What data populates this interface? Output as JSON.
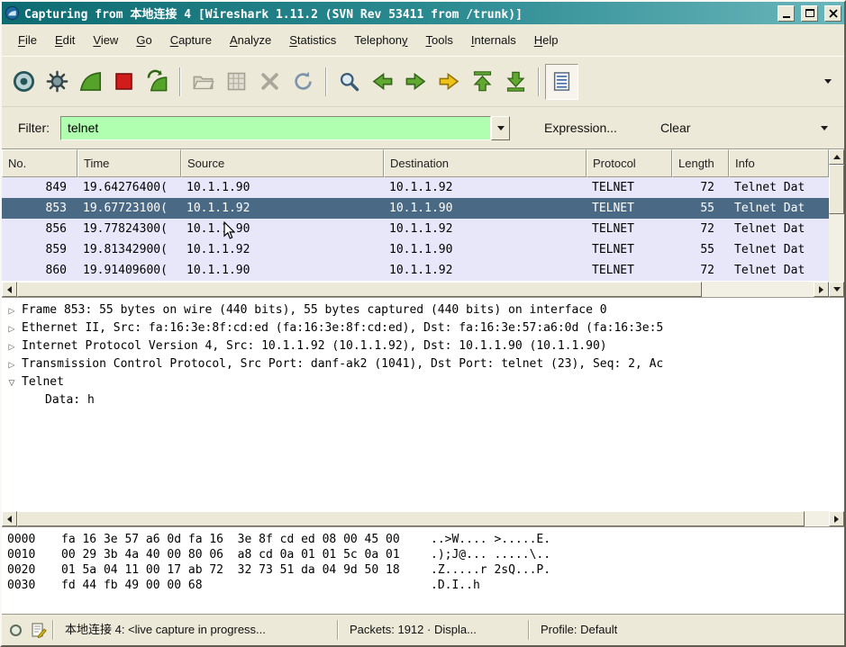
{
  "window": {
    "title": "Capturing from 本地连接 4    [Wireshark 1.11.2  (SVN Rev 53411 from /trunk)]"
  },
  "menu": {
    "items": [
      {
        "label": "File",
        "accel": 0
      },
      {
        "label": "Edit",
        "accel": 0
      },
      {
        "label": "View",
        "accel": 0
      },
      {
        "label": "Go",
        "accel": 0
      },
      {
        "label": "Capture",
        "accel": 0
      },
      {
        "label": "Analyze",
        "accel": 0
      },
      {
        "label": "Statistics",
        "accel": 0
      },
      {
        "label": "Telephony",
        "accel": 8
      },
      {
        "label": "Tools",
        "accel": 0
      },
      {
        "label": "Internals",
        "accel": 0
      },
      {
        "label": "Help",
        "accel": 0
      }
    ]
  },
  "toolbar": {
    "icons": [
      "list-interfaces",
      "capture-options",
      "start-capture",
      "stop-capture",
      "restart-capture",
      "open-file",
      "save-file",
      "close-file",
      "reload",
      "find-packet",
      "go-back",
      "go-forward",
      "go-to-packet",
      "go-to-top",
      "go-to-bottom",
      "colorize-list",
      "overflow-menu"
    ]
  },
  "filter": {
    "label": "Filter:",
    "value": "telnet",
    "expression_button": "Expression...",
    "clear_button": "Clear",
    "valid_bg": "#b0ffb0"
  },
  "packet_list": {
    "columns": [
      "No.",
      "Time",
      "Source",
      "Destination",
      "Protocol",
      "Length",
      "Info"
    ],
    "selected_color": "#4a6984",
    "row_color": "#e8e7f9",
    "rows": [
      {
        "no": "849",
        "time": "19.64276400(",
        "source": "10.1.1.90",
        "destination": "10.1.1.92",
        "protocol": "TELNET",
        "length": "72",
        "info": "Telnet Dat",
        "selected": false
      },
      {
        "no": "853",
        "time": "19.67723100(",
        "source": "10.1.1.92",
        "destination": "10.1.1.90",
        "protocol": "TELNET",
        "length": "55",
        "info": "Telnet Dat",
        "selected": true
      },
      {
        "no": "856",
        "time": "19.77824300(",
        "source": "10.1.1.90",
        "destination": "10.1.1.92",
        "protocol": "TELNET",
        "length": "72",
        "info": "Telnet Dat",
        "selected": false
      },
      {
        "no": "859",
        "time": "19.81342900(",
        "source": "10.1.1.92",
        "destination": "10.1.1.90",
        "protocol": "TELNET",
        "length": "55",
        "info": "Telnet Dat",
        "selected": false
      },
      {
        "no": "860",
        "time": "19.91409600(",
        "source": "10.1.1.90",
        "destination": "10.1.1.92",
        "protocol": "TELNET",
        "length": "72",
        "info": "Telnet Dat",
        "selected": false
      }
    ]
  },
  "details": {
    "lines": [
      {
        "expander": "collapsed",
        "indent": 0,
        "text": "Frame 853: 55 bytes on wire (440 bits), 55 bytes captured (440 bits) on interface 0"
      },
      {
        "expander": "collapsed",
        "indent": 0,
        "text": "Ethernet II, Src: fa:16:3e:8f:cd:ed (fa:16:3e:8f:cd:ed), Dst: fa:16:3e:57:a6:0d (fa:16:3e:5"
      },
      {
        "expander": "collapsed",
        "indent": 0,
        "text": "Internet Protocol Version 4, Src: 10.1.1.92 (10.1.1.92), Dst: 10.1.1.90 (10.1.1.90)"
      },
      {
        "expander": "collapsed",
        "indent": 0,
        "text": "Transmission Control Protocol, Src Port: danf-ak2 (1041), Dst Port: telnet (23), Seq: 2, Ac"
      },
      {
        "expander": "expanded",
        "indent": 0,
        "text": "Telnet"
      },
      {
        "expander": "none",
        "indent": 1,
        "text": "Data: h"
      }
    ]
  },
  "hex_dump": {
    "rows": [
      {
        "offset": "0000",
        "hex": "fa 16 3e 57 a6 0d fa 16  3e 8f cd ed 08 00 45 00",
        "ascii": "..>W.... >.....E."
      },
      {
        "offset": "0010",
        "hex": "00 29 3b 4a 40 00 80 06  a8 cd 0a 01 01 5c 0a 01",
        "ascii": ".);J@... .....\\.."
      },
      {
        "offset": "0020",
        "hex": "01 5a 04 11 00 17 ab 72  32 73 51 da 04 9d 50 18",
        "ascii": ".Z.....r 2sQ...P."
      },
      {
        "offset": "0030",
        "hex": "fd 44 fb 49 00 00 68",
        "ascii": ".D.I..h"
      }
    ]
  },
  "status_bar": {
    "capture_field": "本地连接 4: <live capture in progress...",
    "packets_field": "Packets: 1912 · Displa...",
    "profile_field": "Profile: Default"
  }
}
